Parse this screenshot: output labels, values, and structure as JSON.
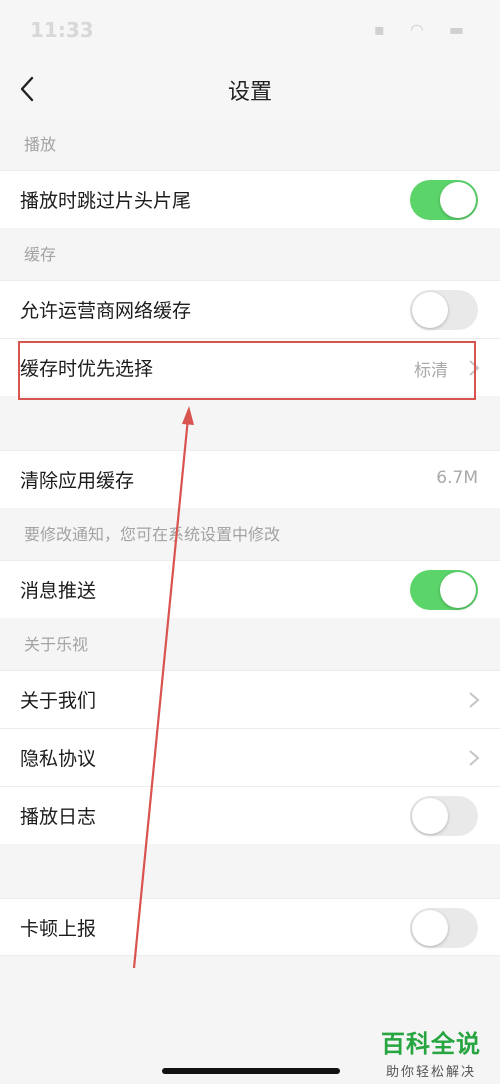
{
  "status_bar": {
    "time": "11:33",
    "icons": "▪ ◠ ▬"
  },
  "nav": {
    "title": "设置"
  },
  "sections": {
    "playback": "播放",
    "cache": "缓存",
    "notify": "要修改通知，您可在系统设置中修改",
    "about": "关于乐视"
  },
  "rows": {
    "skip_intro": {
      "label": "播放时跳过片头片尾",
      "toggle": "on"
    },
    "carrier_cache": {
      "label": "允许运营商网络缓存",
      "toggle": "off"
    },
    "cache_quality": {
      "label": "缓存时优先选择",
      "value": "标清"
    },
    "clear_cache": {
      "label": "清除应用缓存",
      "value": "6.7M"
    },
    "push": {
      "label": "消息推送",
      "toggle": "on"
    },
    "about_us": {
      "label": "关于我们"
    },
    "privacy": {
      "label": "隐私协议"
    },
    "play_log": {
      "label": "播放日志",
      "toggle": "off"
    },
    "lag_report": {
      "label": "卡顿上报",
      "toggle": "off"
    }
  },
  "watermark": {
    "title": "百科全说",
    "subtitle": "助你轻松解决"
  },
  "colors": {
    "toggle_on": "#5bd46a",
    "highlight": "#d9534f",
    "brand": "#26a541"
  }
}
